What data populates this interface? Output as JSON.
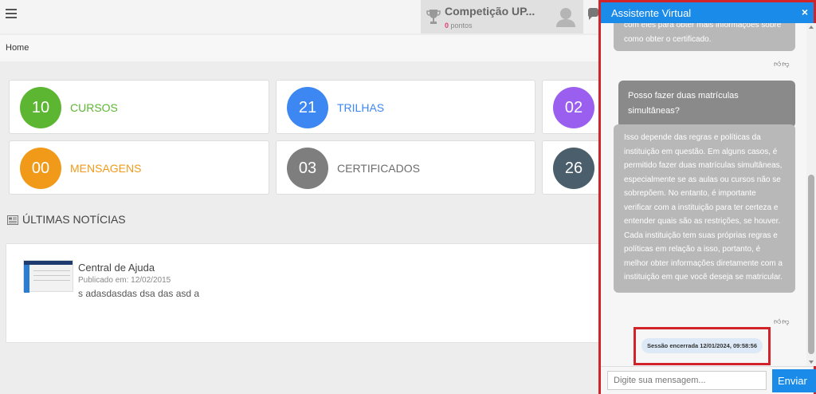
{
  "header": {
    "competition": {
      "title": "Competição UP...",
      "points_value": "0",
      "points_label": "pontos"
    }
  },
  "breadcrumb": {
    "label": "Home"
  },
  "cards": [
    {
      "value": "10",
      "label": "CURSOS",
      "color": "#5cb632",
      "label_color": "#5cb632"
    },
    {
      "value": "21",
      "label": "TRILHAS",
      "color": "#3d87f2",
      "label_color": "#3d87f2"
    },
    {
      "value": "02",
      "label": "",
      "color": "#9b5ff0",
      "label_color": "#9b5ff0"
    },
    {
      "value": "00",
      "label": "MENSAGENS",
      "color": "#f19a1a",
      "label_color": "#f19a1a"
    },
    {
      "value": "03",
      "label": "CERTIFICADOS",
      "color": "#7e7e7e",
      "label_color": "#6d6d6d"
    },
    {
      "value": "26",
      "label": "",
      "color": "#4a5e6b",
      "label_color": "#4a5e6b"
    }
  ],
  "news": {
    "header": "ÚLTIMAS NOTÍCIAS",
    "items": [
      {
        "title": "Central de Ajuda",
        "date": "Publicado em: 12/02/2015",
        "body": "s adasdasdas dsa das asd a"
      }
    ]
  },
  "chat": {
    "title": "Assistente Virtual",
    "close": "×",
    "messages": [
      {
        "from": "bot",
        "text": "com eles para obter mais informações sobre como obter o certificado."
      },
      {
        "from": "user",
        "text": "Posso fazer duas matrículas simultâneas?"
      },
      {
        "from": "bot",
        "text": "Isso depende das regras e políticas da instituição em questão. Em alguns casos, é permitido fazer duas matrículas simultâneas, especialmente se as aulas ou cursos não se sobrepõem. No entanto, é importante verificar com a instituição para ter certeza e entender quais são as restrições, se houver. Cada instituição tem suas próprias regras e políticas em relação a isso, portanto, é melhor obter informações diretamente com a instituição em que você deseja se matricular."
      }
    ],
    "session_status": "Sessão encerrada 12/01/2024, 09:58:56",
    "input_placeholder": "Digite sua mensagem...",
    "send_label": "Enviar"
  }
}
